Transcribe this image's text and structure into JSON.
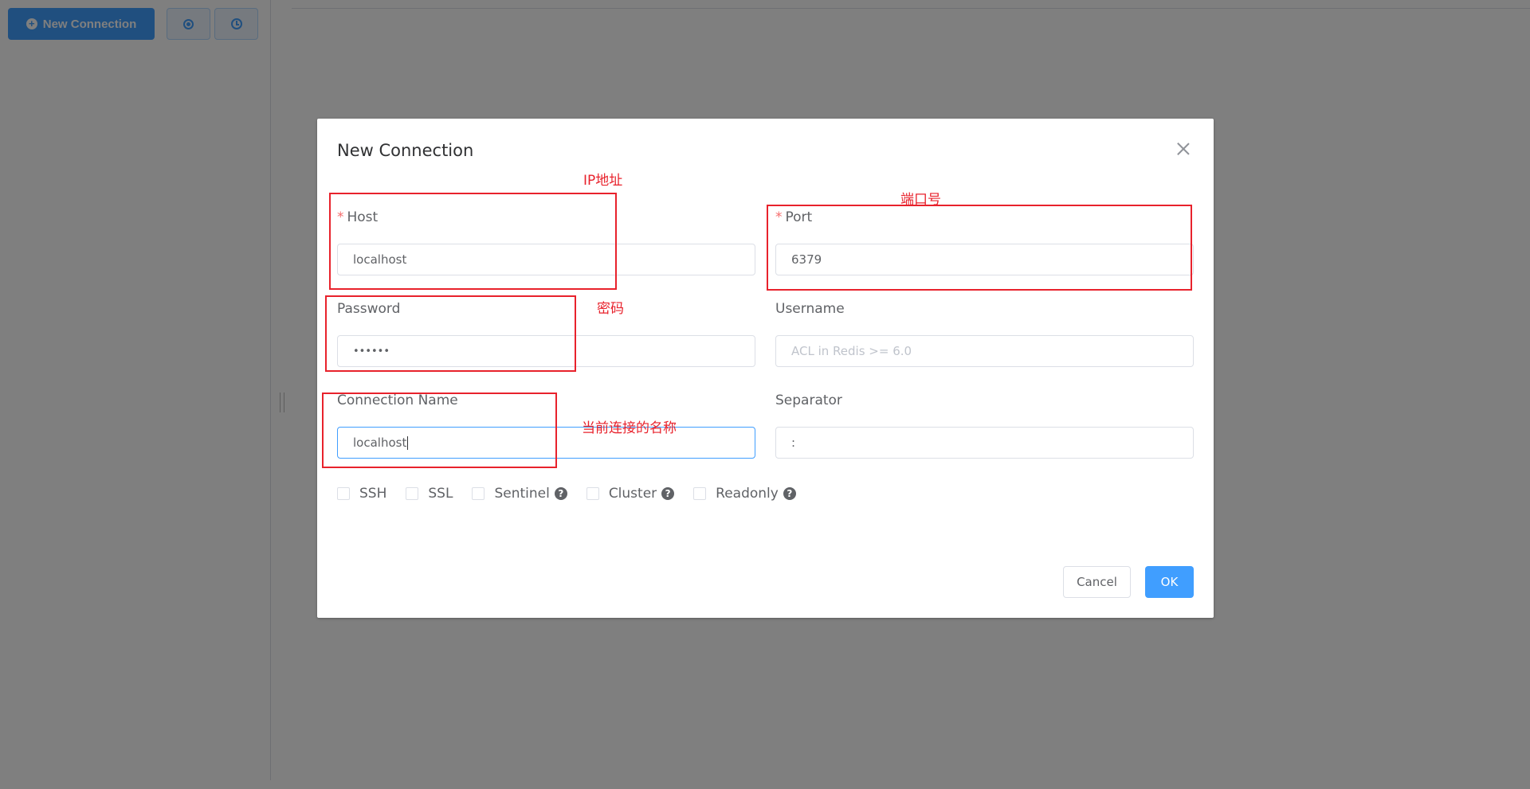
{
  "toolbar": {
    "new_connection_label": "New Connection"
  },
  "dialog": {
    "title": "New Connection",
    "host": {
      "label": "Host",
      "value": "localhost"
    },
    "port": {
      "label": "Port",
      "value": "6379"
    },
    "password": {
      "label": "Password",
      "value": "••••••"
    },
    "username": {
      "label": "Username",
      "placeholder": "ACL in Redis >= 6.0"
    },
    "connection_name": {
      "label": "Connection Name",
      "value": "localhost"
    },
    "separator": {
      "label": "Separator",
      "value": ":"
    },
    "options": [
      {
        "label": "SSH",
        "help": false
      },
      {
        "label": "SSL",
        "help": false
      },
      {
        "label": "Sentinel",
        "help": true
      },
      {
        "label": "Cluster",
        "help": true
      },
      {
        "label": "Readonly",
        "help": true
      }
    ],
    "cancel_label": "Cancel",
    "ok_label": "OK"
  },
  "annotations": {
    "host_note": "IP地址",
    "port_note": "端口号",
    "password_note": "密码",
    "name_note": "当前连接的名称"
  },
  "colors": {
    "accent": "#409eff",
    "annotation": "#e8222c",
    "required": "#f56c6c"
  }
}
